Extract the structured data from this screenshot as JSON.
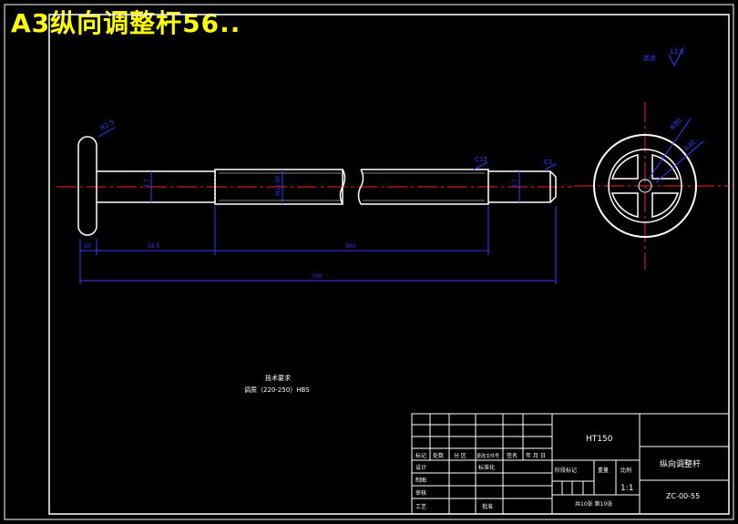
{
  "watermark": "A3纵向调整杆56..",
  "surface_note": {
    "label": "其余",
    "value": "12.5"
  },
  "tech": {
    "title": "技术要求",
    "line": "调质（220-250）HBS"
  },
  "dims": {
    "head_radius": "R2.5",
    "dia_left": "8.7",
    "dia_mid": "M12-6h",
    "chamfer_right": "C15",
    "dia_right": "8.7",
    "end_chamfer": "C1",
    "len_head": "10",
    "len_shoulder": "58.5",
    "len_thread": "360",
    "len_total": "700",
    "wheel_r1": "R20",
    "wheel_r2": "R40",
    "wheel_d": "Ф80"
  },
  "title_block": {
    "material": "HT150",
    "name": "纵向调整杆",
    "drawing_no": "ZC-00-55",
    "scale": "1:1",
    "row_headers": [
      "标记",
      "处数",
      "分 区",
      "更改文件号",
      "签名",
      "年 月 日"
    ],
    "row_labels": [
      "设计",
      "制图",
      "审核",
      "工艺"
    ],
    "std_label": "标准化",
    "approve_label": "批准",
    "stage_label": "阶段标记",
    "weight_label": "重量",
    "ratio_label": "比例",
    "sheets": "共10张 第10张"
  }
}
